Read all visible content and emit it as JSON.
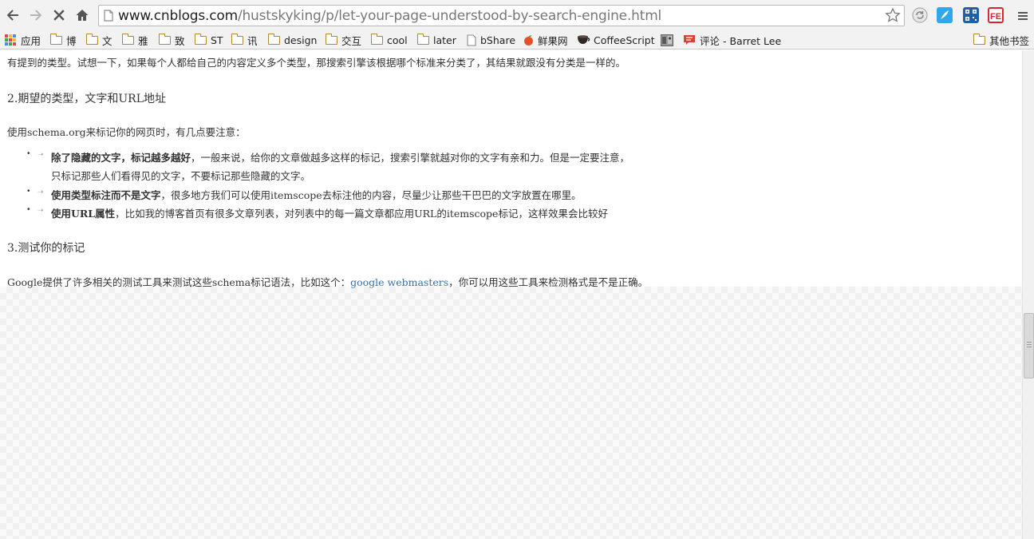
{
  "browser": {
    "url_host": "www.cnblogs.com",
    "url_path": "/hustskyking/p/let-your-page-understood-by-search-engine.html",
    "colors": {
      "toolbar_bg": "#f2f2f2",
      "link": "#3a6ea5"
    }
  },
  "toolbar": {
    "back_icon": "back-arrow-icon",
    "forward_icon": "forward-arrow-icon",
    "stop_icon": "stop-x-icon",
    "home_icon": "home-icon",
    "star_icon": "bookmark-star-icon",
    "extensions": [
      "refresh-ext-icon",
      "feather-ext-icon",
      "qr-code-ext-icon",
      "fe-ext-icon"
    ],
    "menu_icon": "hamburger-menu-icon"
  },
  "bookmarks": {
    "items": [
      {
        "label": "应用",
        "icon": "apps-grid-icon"
      },
      {
        "label": "博",
        "icon": "folder-icon"
      },
      {
        "label": "文",
        "icon": "folder-icon"
      },
      {
        "label": "雅",
        "icon": "folder-icon"
      },
      {
        "label": "致",
        "icon": "folder-icon"
      },
      {
        "label": "ST",
        "icon": "folder-icon"
      },
      {
        "label": "讯",
        "icon": "folder-icon"
      },
      {
        "label": "design",
        "icon": "folder-icon"
      },
      {
        "label": "交互",
        "icon": "folder-icon"
      },
      {
        "label": "cool",
        "icon": "folder-icon"
      },
      {
        "label": "later",
        "icon": "folder-icon"
      },
      {
        "label": "bShare",
        "icon": "page-icon"
      },
      {
        "label": "鲜果网",
        "icon": "fruit-icon"
      },
      {
        "label": "CoffeeScript",
        "icon": "coffee-cup-icon"
      },
      {
        "label": "",
        "icon": "image-thumbnail-icon"
      },
      {
        "label": "评论 - Barret Lee",
        "icon": "comment-icon"
      }
    ],
    "other": {
      "label": "其他书签",
      "icon": "folder-icon"
    }
  },
  "article": {
    "line0": "有提到的类型。试想一下，如果每个人都给自己的内容定义多个类型，那搜索引擎该根据哪个标准来分类了，其结果就跟没有分类是一样的。",
    "heading2": "2.期望的类型，文字和URL地址",
    "intro2": "使用schema.org来标记你的网页时，有几点要注意：",
    "list": [
      {
        "strong": "除了隐藏的文字，标记越多越好",
        "text": "，一般来说，给你的文章做越多这样的标记，搜索引擎就越对你的文字有亲和力。但是一定要注意，",
        "text2": "只标记那些人们看得见的文字，不要标记那些隐藏的文字。"
      },
      {
        "strong": "使用类型标注而不是文字",
        "text": "，很多地方我们可以使用itemscope去标注他的内容，尽量少让那些干巴巴的文字放置在哪里。"
      },
      {
        "strong": "使用URL属性",
        "text": "，比如我的博客首页有很多文章列表，对列表中的每一篇文章都应用URL的itemscope标记，这样效果会比较好"
      }
    ],
    "heading3": "3.测试你的标记",
    "para3_before": "Google提供了许多相关的测试工具来测试这些schema标记语法，比如这个：",
    "para3_link": "google webmasters",
    "para3_after": "，你可以用这些工具来检测格式是不是正确。"
  }
}
